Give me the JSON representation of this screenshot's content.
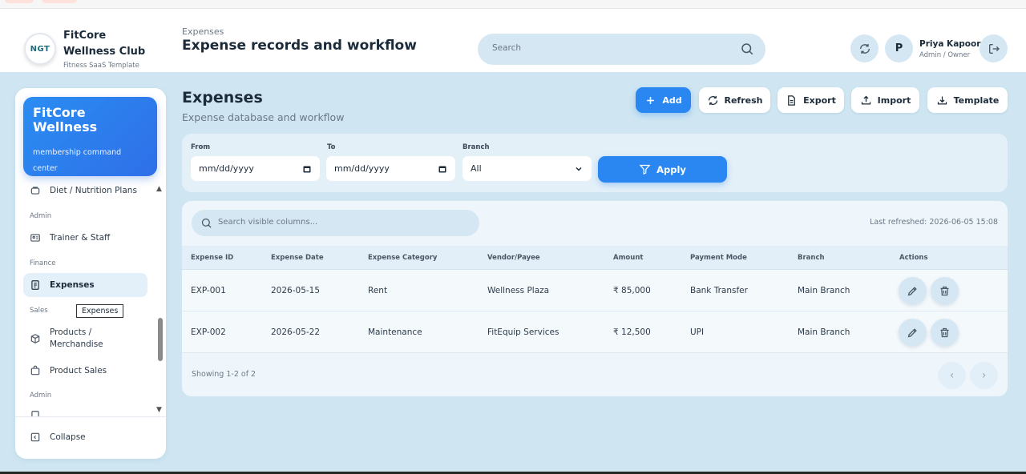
{
  "header": {
    "brand_name": "FitCore Wellness Club",
    "brand_sub": "Fitness SaaS Template",
    "logo_text": "NGT",
    "crumb": "Expenses",
    "title": "Expense records and workflow",
    "search_placeholder": "Search",
    "avatar_initial": "P",
    "user_name": "Priya Kapoor",
    "user_role": "Admin / Owner"
  },
  "sidebar": {
    "card_title": "FitCore Wellness",
    "card_sub": "membership command center",
    "items": [
      {
        "label": "Diet / Nutrition Plans",
        "icon": "diet-icon"
      },
      {
        "section": "Admin"
      },
      {
        "label": "Trainer & Staff",
        "icon": "id-card-icon"
      },
      {
        "section": "Finance"
      },
      {
        "label": "Expenses",
        "icon": "receipt-icon",
        "active": true
      },
      {
        "section": "Sales"
      },
      {
        "label": "Products / Merchandise",
        "icon": "box-icon"
      },
      {
        "label": "Product Sales",
        "icon": "bag-icon"
      },
      {
        "section": "Admin"
      }
    ],
    "labels": {
      "diet": "Diet / Nutrition Plans",
      "admin1": "Admin",
      "trainer": "Trainer & Staff",
      "finance": "Finance",
      "expenses": "Expenses",
      "sales": "Sales",
      "products": "Products / Merchandise",
      "product_sales": "Product Sales",
      "admin2": "Admin",
      "collapse": "Collapse"
    },
    "tooltip": "Expenses"
  },
  "main": {
    "title": "Expenses",
    "subtitle": "Expense database and workflow",
    "toolbar": {
      "add": "Add",
      "refresh": "Refresh",
      "export": "Export",
      "import": "Import",
      "template": "Template"
    },
    "filters": {
      "from_label": "From",
      "from_value": "mm/dd/yyyy",
      "to_label": "To",
      "to_value": "mm/dd/yyyy",
      "branch_label": "Branch",
      "branch_value": "All",
      "apply": "Apply"
    },
    "table": {
      "search_placeholder": "Search visible columns...",
      "last_refreshed": "Last refreshed: 2026-06-05 15:08",
      "columns": [
        "Expense ID",
        "Expense Date",
        "Expense Category",
        "Vendor/Payee",
        "Amount",
        "Payment Mode",
        "Branch",
        "Actions"
      ],
      "rows": [
        [
          "EXP-001",
          "2026-05-15",
          "Rent",
          "Wellness Plaza",
          "₹ 85,000",
          "Bank Transfer",
          "Main Branch"
        ],
        [
          "EXP-002",
          "2026-05-22",
          "Maintenance",
          "FitEquip Services",
          "₹ 12,500",
          "UPI",
          "Main Branch"
        ]
      ],
      "showing": "Showing 1-2 of 2"
    }
  },
  "colors": {
    "accent": "#2a86f0",
    "background": "#cfe6f2",
    "panel": "#e4f0f8"
  }
}
